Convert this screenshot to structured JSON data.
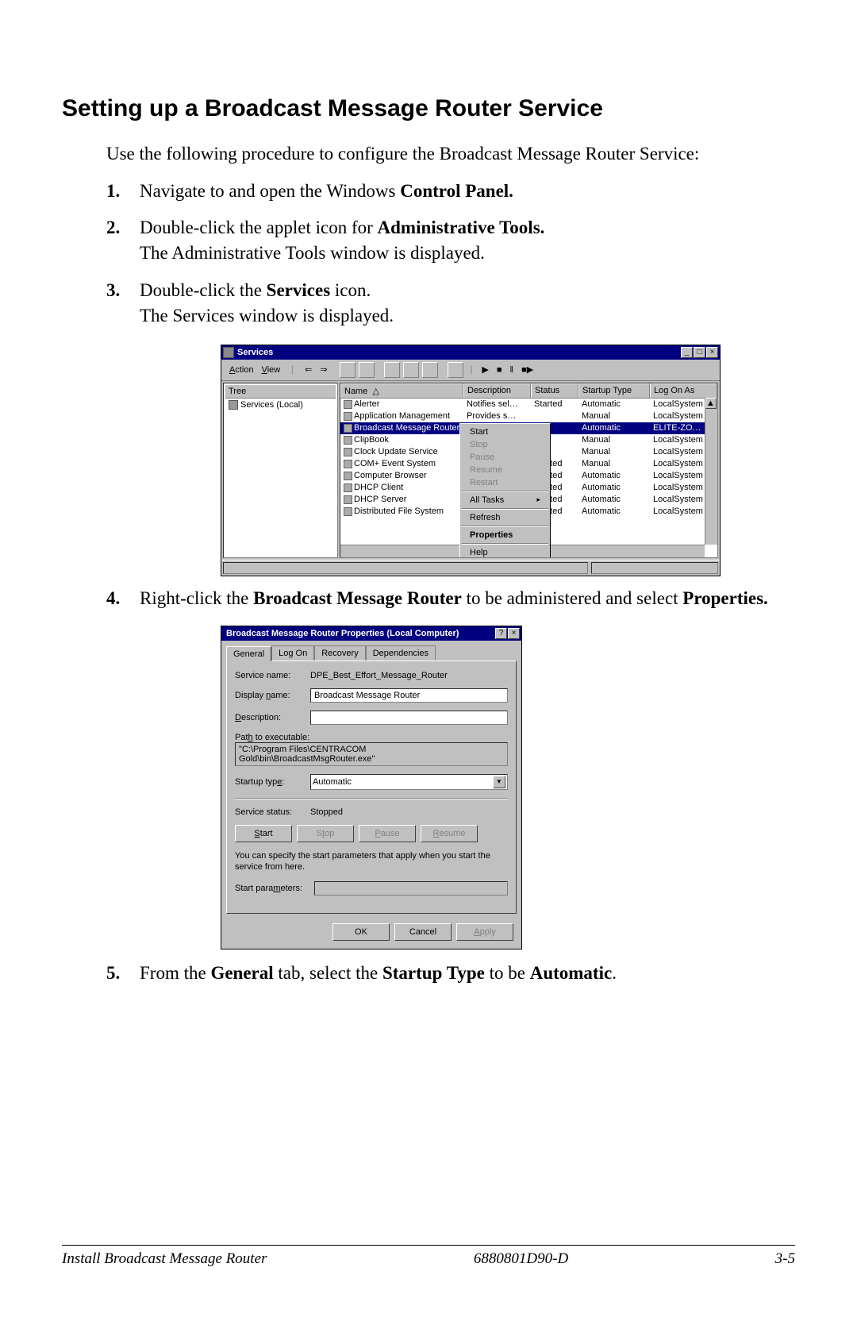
{
  "page": {
    "heading": "Setting up a Broadcast Message Router Service",
    "intro": "Use the following procedure to configure the Broadcast Message Router Service:",
    "steps": {
      "s1_num": "1.",
      "s1_a": "Navigate to and open the Windows ",
      "s1_b": "Control Panel.",
      "s2_num": "2.",
      "s2_a": "Double-click the applet icon for ",
      "s2_b": "Administrative Tools.",
      "s2_c": "The Administrative Tools window is displayed.",
      "s3_num": "3.",
      "s3_a": "Double-click the ",
      "s3_b": "Services",
      "s3_c": " icon.",
      "s3_d": "The Services window is displayed.",
      "s4_num": "4.",
      "s4_a": "Right-click the ",
      "s4_b": "Broadcast Message Router",
      "s4_c": " to be administered and select ",
      "s4_d": "Properties.",
      "s5_num": "5.",
      "s5_a": "From the ",
      "s5_b": "General",
      "s5_c": " tab, select the ",
      "s5_d": "Startup Type",
      "s5_e": " to be ",
      "s5_f": "Automatic",
      "s5_g": "."
    },
    "footer": {
      "left": "Install Broadcast Message Router",
      "mid": "6880801D90-D",
      "right": "3-5"
    }
  },
  "servicesWin": {
    "title": "Services",
    "menu": {
      "action": "Action",
      "view": "View"
    },
    "tree": {
      "header": "Tree",
      "item": "Services (Local)"
    },
    "cols": {
      "name": "Name",
      "desc": "Description",
      "status": "Status",
      "stype": "Startup Type",
      "log": "Log On As"
    },
    "rows": [
      {
        "name": "Alerter",
        "desc": "Notifies sel…",
        "status": "Started",
        "stype": "Automatic",
        "log": "LocalSystem"
      },
      {
        "name": "Application Management",
        "desc": "Provides s…",
        "status": "",
        "stype": "Manual",
        "log": "LocalSystem"
      },
      {
        "name": "Broadcast Message Router",
        "desc": "",
        "status": "",
        "stype": "Automatic",
        "log": "ELITE-ZO…",
        "sel": true
      },
      {
        "name": "ClipBook",
        "desc": "",
        "status": "",
        "stype": "Manual",
        "log": "LocalSystem"
      },
      {
        "name": "Clock Update Service",
        "desc": "",
        "status": "",
        "stype": "Manual",
        "log": "LocalSystem"
      },
      {
        "name": "COM+ Event System",
        "desc": "…",
        "status": "Started",
        "stype": "Manual",
        "log": "LocalSystem"
      },
      {
        "name": "Computer Browser",
        "desc": "…",
        "status": "Started",
        "stype": "Automatic",
        "log": "LocalSystem"
      },
      {
        "name": "DHCP Client",
        "desc": "…",
        "status": "Started",
        "stype": "Automatic",
        "log": "LocalSystem"
      },
      {
        "name": "DHCP Server",
        "desc": "…",
        "status": "Started",
        "stype": "Automatic",
        "log": "LocalSystem"
      },
      {
        "name": "Distributed File System",
        "desc": "…",
        "status": "Started",
        "stype": "Automatic",
        "log": "LocalSystem"
      }
    ],
    "ctx": {
      "start": "Start",
      "stop": "Stop",
      "pause": "Pause",
      "resume": "Resume",
      "restart": "Restart",
      "alltasks": "All Tasks",
      "refresh": "Refresh",
      "props": "Properties",
      "help": "Help"
    }
  },
  "propDlg": {
    "title": "Broadcast Message Router Properties (Local Computer)",
    "tabs": {
      "general": "General",
      "logon": "Log On",
      "recovery": "Recovery",
      "deps": "Dependencies"
    },
    "labels": {
      "svcname": "Service name:",
      "dispname": "Display name:",
      "desc": "Description:",
      "path": "Path to executable:",
      "stype": "Startup type:",
      "sstatus": "Service status:",
      "startparams": "Start parameters:"
    },
    "values": {
      "svcname": "DPE_Best_Effort_Message_Router",
      "dispname": "Broadcast Message Router",
      "desc": "",
      "path": "\"C:\\Program Files\\CENTRACOM Gold\\bin\\BroadcastMsgRouter.exe\"",
      "stype": "Automatic",
      "sstatus": "Stopped",
      "startparams": ""
    },
    "note": "You can specify the start parameters that apply when you start the service from here.",
    "btns": {
      "start": "Start",
      "stop": "Stop",
      "pause": "Pause",
      "resume": "Resume",
      "ok": "OK",
      "cancel": "Cancel",
      "apply": "Apply"
    }
  }
}
